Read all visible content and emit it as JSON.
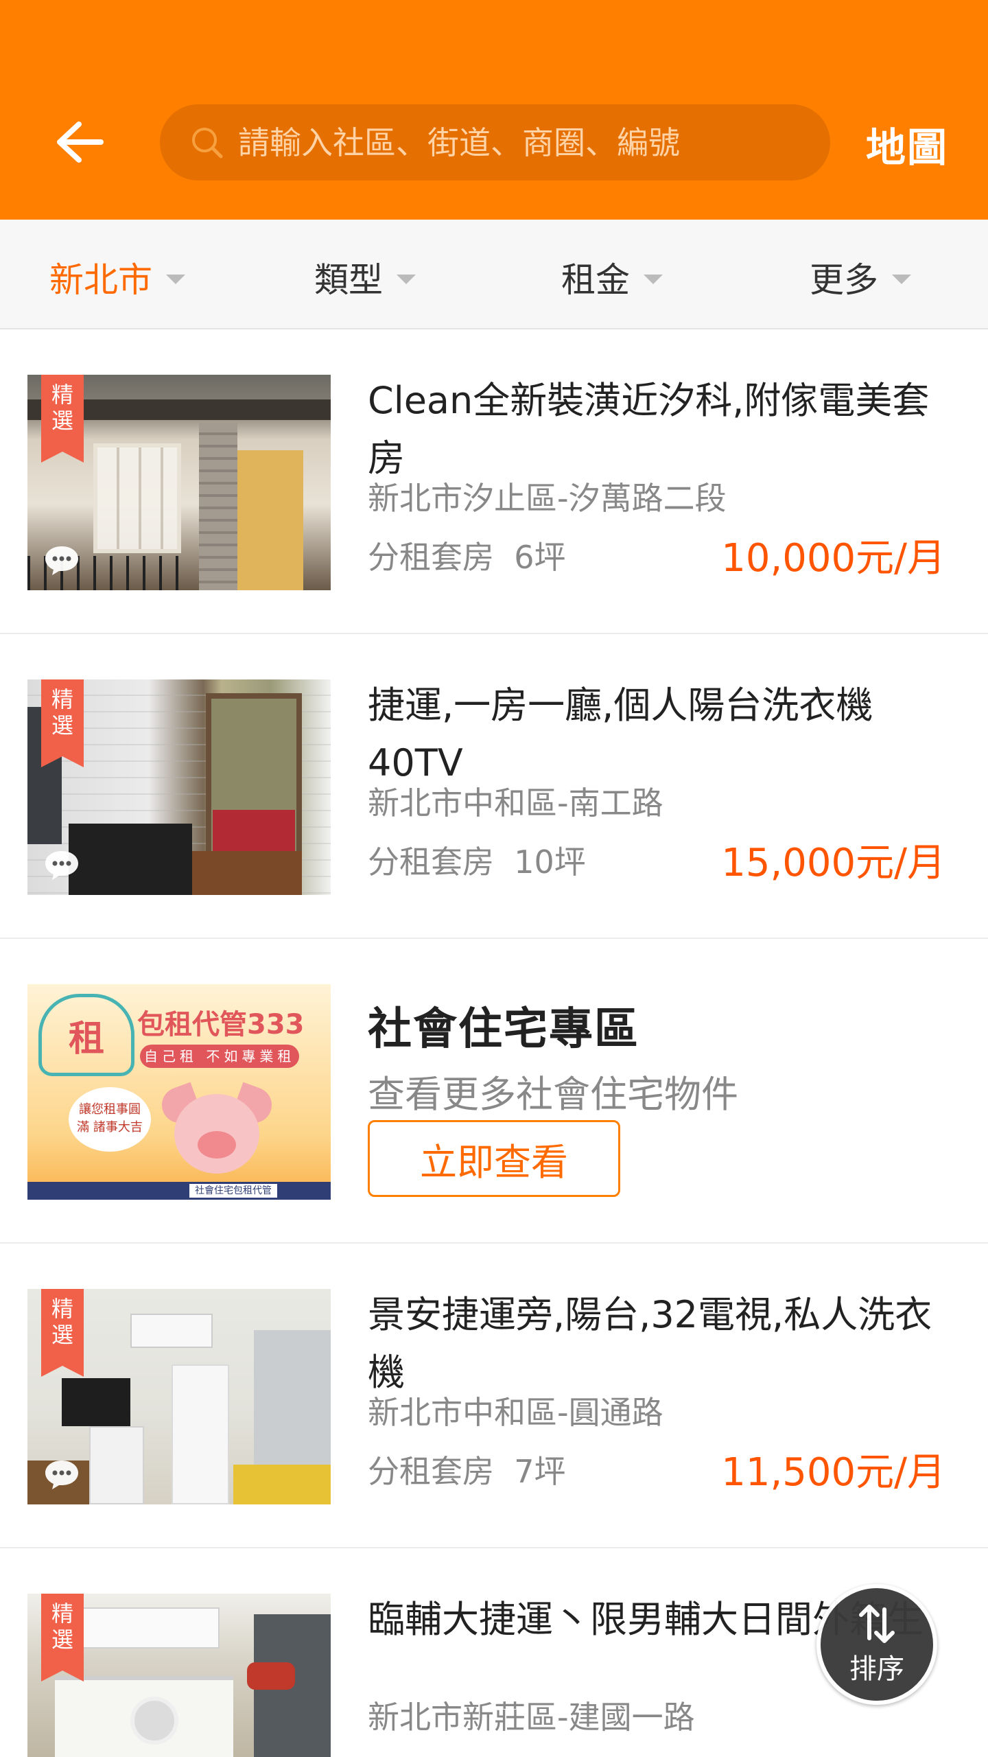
{
  "header": {
    "search_placeholder": "請輸入社區、街道、商圈、編號",
    "map_label": "地圖",
    "colors": {
      "background": "#ff8000",
      "search_bg": "#e56f00"
    }
  },
  "filters": [
    {
      "label": "新北市",
      "active": true
    },
    {
      "label": "類型",
      "active": false
    },
    {
      "label": "租金",
      "active": false
    },
    {
      "label": "更多",
      "active": false
    }
  ],
  "listings": [
    {
      "badge": [
        "精",
        "選"
      ],
      "title": "Clean全新裝潢近汐科,附傢電美套房",
      "address": "新北市汐止區-汐萬路二段",
      "type": "分租套房",
      "size": "6坪",
      "price": "10,000元/月"
    },
    {
      "badge": [
        "精",
        "選"
      ],
      "title": "捷運,一房一廳,個人陽台洗衣機40TV",
      "address": "新北市中和區-南工路",
      "type": "分租套房",
      "size": "10坪",
      "price": "15,000元/月"
    },
    {
      "badge": [
        "精",
        "選"
      ],
      "title": "景安捷運旁,陽台,32電視,私人洗衣機",
      "address": "新北市中和區-圓通路",
      "type": "分租套房",
      "size": "7坪",
      "price": "11,500元/月"
    },
    {
      "badge": [
        "精",
        "選"
      ],
      "title": "臨輔大捷運丶限男輔大日間外籍生",
      "address": "新北市新莊區-建國一路"
    }
  ],
  "promo": {
    "title": "社會住宅專區",
    "subtitle": "查看更多社會住宅物件",
    "button": "立即查看",
    "banner": {
      "logo_char": "租",
      "brand": "包租代管333",
      "tagline": "自己租 不如專業租",
      "bubble": "讓您租事圓滿 諸事大吉",
      "footer": "社會住宅包租代管"
    }
  },
  "sort_fab": {
    "label": "排序"
  },
  "accent_colors": {
    "price": "#ff5500",
    "active_filter": "#ff6a00",
    "badge": "#f1614a"
  }
}
